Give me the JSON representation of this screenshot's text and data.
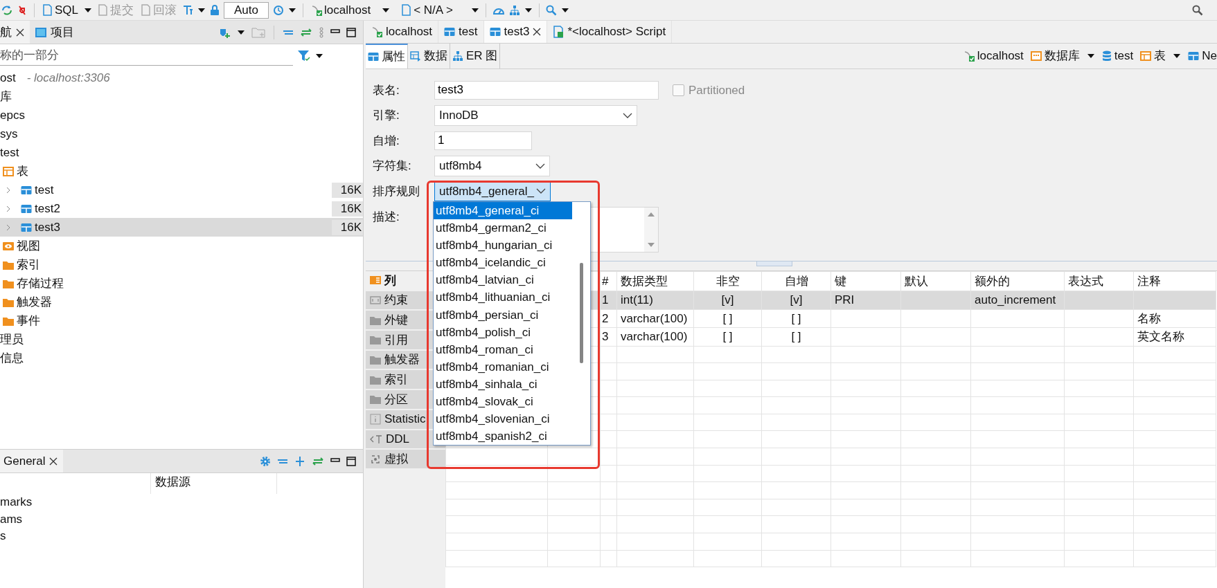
{
  "toolbar": {
    "sql": "SQL",
    "commit": {
      "label": "提交",
      "disabled": true
    },
    "rollback": {
      "label": "回滚",
      "disabled": true
    },
    "mode": "Auto",
    "connection": "localhost",
    "database": "< N/A >"
  },
  "navigator": {
    "tabs": [
      {
        "label": "航",
        "selected": true,
        "closable": true
      },
      {
        "label": "项目",
        "selected": false,
        "closable": false
      }
    ],
    "filter_placeholder": "称的一部分",
    "tree": [
      {
        "label": "ost",
        "detail": "- localhost:3306",
        "children": [
          {
            "label": "库",
            "children": [
              {
                "label": "epcs"
              },
              {
                "label": "sys"
              },
              {
                "label": "test",
                "children": [
                  {
                    "label": "表",
                    "kind": "tables",
                    "children": [
                      {
                        "label": "test",
                        "kind": "table",
                        "expanded": false,
                        "size": "16K",
                        "selected": false
                      },
                      {
                        "label": "test2",
                        "kind": "table",
                        "expanded": false,
                        "size": "16K",
                        "selected": false
                      },
                      {
                        "label": "test3",
                        "kind": "table",
                        "expanded": false,
                        "size": "16K",
                        "selected": true
                      }
                    ]
                  },
                  {
                    "label": "视图",
                    "kind": "views"
                  },
                  {
                    "label": "索引",
                    "kind": "folder"
                  },
                  {
                    "label": "存储过程",
                    "kind": "folder"
                  },
                  {
                    "label": "触发器",
                    "kind": "folder"
                  },
                  {
                    "label": "事件",
                    "kind": "folder"
                  }
                ]
              }
            ]
          },
          {
            "label": "理员"
          },
          {
            "label": "信息"
          }
        ]
      }
    ]
  },
  "projects": {
    "tabs": [
      {
        "label": "General",
        "selected": true,
        "closable": true
      }
    ],
    "column_2": "数据源",
    "rows": [
      "marks",
      "ams",
      "s"
    ]
  },
  "editor": {
    "tabs": [
      {
        "label": "localhost",
        "kind": "connection",
        "selected": false
      },
      {
        "label": "test",
        "kind": "table",
        "selected": false
      },
      {
        "label": "test3",
        "kind": "table",
        "selected": true
      },
      {
        "label": "*<localhost> Script",
        "kind": "script",
        "selected": false
      }
    ],
    "subtabs": [
      {
        "label": "属性",
        "kind": "properties",
        "selected": true
      },
      {
        "label": "数据",
        "kind": "data",
        "selected": false
      },
      {
        "label": "ER 图",
        "kind": "er",
        "selected": false
      }
    ],
    "breadcrumb": [
      {
        "label": "localhost",
        "kind": "connection",
        "menu": false
      },
      {
        "label": "数据库",
        "kind": "databases",
        "menu": true
      },
      {
        "label": "test",
        "kind": "database",
        "menu": false
      },
      {
        "label": "表",
        "kind": "tables",
        "menu": true
      },
      {
        "label": "Ne",
        "kind": "table",
        "menu": false
      }
    ],
    "form": [
      {
        "label": "表名:",
        "kind": "text",
        "value": "test3"
      },
      {
        "label": "引擎:",
        "kind": "select",
        "value": "InnoDB"
      },
      {
        "label": "自增:",
        "kind": "text",
        "value": "1"
      },
      {
        "label": "字符集:",
        "kind": "select",
        "value": "utf8mb4"
      },
      {
        "label": "排序规则",
        "kind": "select",
        "value": "utf8mb4_general_",
        "open": true
      },
      {
        "label": "描述:",
        "kind": "textarea"
      }
    ],
    "partitioned": {
      "label": "Partitioned",
      "checked": false,
      "disabled": true
    },
    "collation_options": [
      {
        "label": "utf8mb4_general_ci",
        "selected": true
      },
      {
        "label": "utf8mb4_german2_ci",
        "selected": false
      },
      {
        "label": "utf8mb4_hungarian_ci",
        "selected": false
      },
      {
        "label": "utf8mb4_icelandic_ci",
        "selected": false
      },
      {
        "label": "utf8mb4_latvian_ci",
        "selected": false
      },
      {
        "label": "utf8mb4_lithuanian_ci",
        "selected": false
      },
      {
        "label": "utf8mb4_persian_ci",
        "selected": false
      },
      {
        "label": "utf8mb4_polish_ci",
        "selected": false
      },
      {
        "label": "utf8mb4_roman_ci",
        "selected": false
      },
      {
        "label": "utf8mb4_romanian_ci",
        "selected": false
      },
      {
        "label": "utf8mb4_sinhala_ci",
        "selected": false
      },
      {
        "label": "utf8mb4_slovak_ci",
        "selected": false
      },
      {
        "label": "utf8mb4_slovenian_ci",
        "selected": false
      },
      {
        "label": "utf8mb4_spanish2_ci",
        "selected": false
      }
    ],
    "side_tabs": [
      {
        "label": "列",
        "kind": "columns",
        "selected": true
      },
      {
        "label": "约束",
        "kind": "constraints",
        "selected": false
      },
      {
        "label": "外键",
        "kind": "folder",
        "selected": false
      },
      {
        "label": "引用",
        "kind": "folder",
        "selected": false
      },
      {
        "label": "触发器",
        "kind": "folder",
        "selected": false
      },
      {
        "label": "索引",
        "kind": "folder",
        "selected": false
      },
      {
        "label": "分区",
        "kind": "folder",
        "selected": false
      },
      {
        "label": "Statistic",
        "kind": "info",
        "selected": false
      },
      {
        "label": "DDL",
        "kind": "ddl",
        "selected": false
      },
      {
        "label": "虚拟",
        "kind": "virtual",
        "selected": false
      }
    ],
    "table": {
      "columns": [
        "#",
        "数据类型",
        "非空",
        "自增",
        "键",
        "默认",
        "额外的",
        "表达式",
        "注释"
      ],
      "rows": [
        {
          "selected": true,
          "cells": [
            "1",
            "int(11)",
            "[v]",
            "[v]",
            "PRI",
            null,
            "auto_increment",
            null,
            null
          ]
        },
        {
          "selected": false,
          "cells": [
            "2",
            "varchar(100)",
            "[ ]",
            "[ ]",
            null,
            null,
            null,
            null,
            "名称"
          ]
        },
        {
          "selected": false,
          "cells": [
            "3",
            "varchar(100)",
            "[ ]",
            "[ ]",
            null,
            null,
            null,
            null,
            "英文名称"
          ]
        }
      ]
    }
  }
}
